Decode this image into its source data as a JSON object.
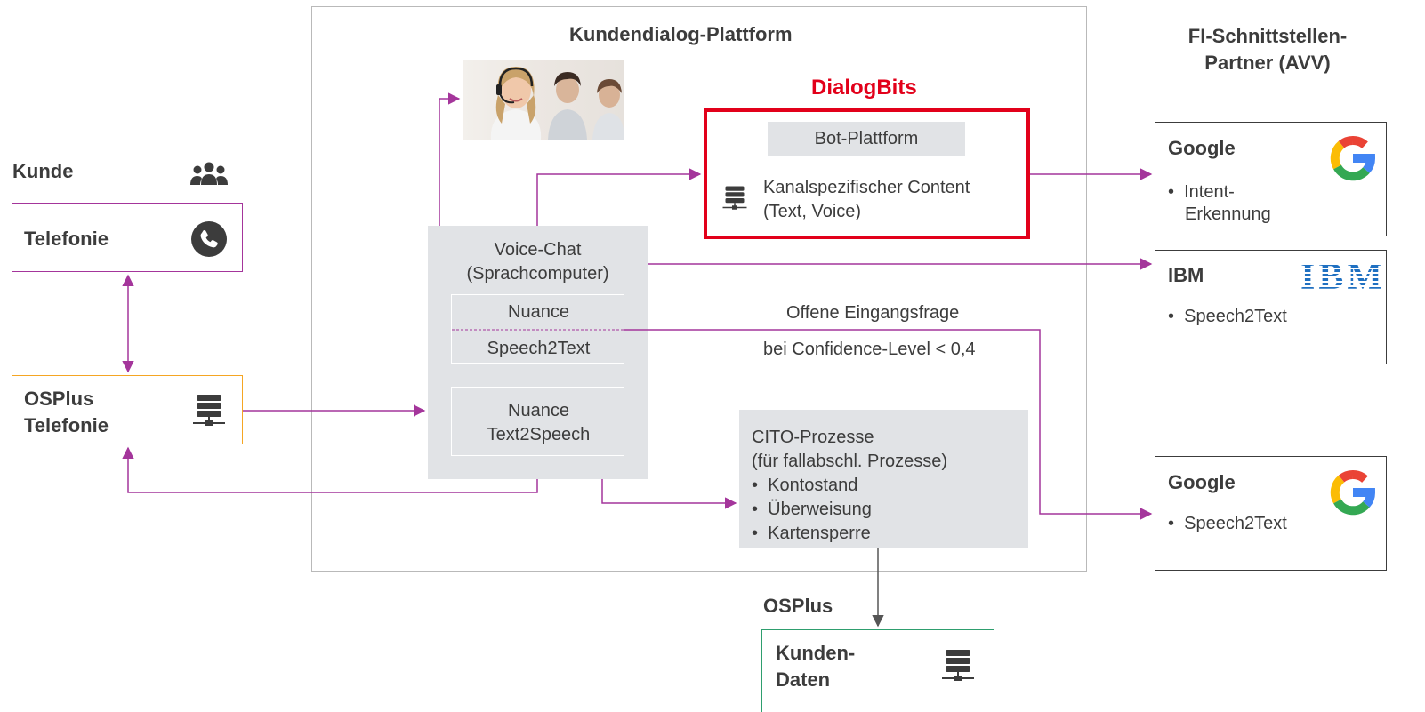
{
  "platform": {
    "title": "Kundendialog-Plattform"
  },
  "partners": {
    "title_line1": "FI-Schnittstellen-",
    "title_line2": "Partner (AVV)"
  },
  "customer": {
    "label": "Kunde",
    "telephony": "Telefonie"
  },
  "osplus_telephony": {
    "line1": "OSPlus",
    "line2": "Telefonie"
  },
  "dialogbits": {
    "title": "DialogBits",
    "bot_platform": "Bot-Plattform",
    "content_line1": "Kanalspezifischer Content",
    "content_line2": "(Text, Voice)"
  },
  "voice_chat": {
    "line1": "Voice-Chat",
    "line2": "(Sprachcomputer)",
    "nuance": "Nuance",
    "speech2text": "Speech2Text",
    "tts_line1": "Nuance",
    "tts_line2": "Text2Speech"
  },
  "annotation": {
    "line1": "Offene Eingangsfrage",
    "line2": "bei Confidence-Level < 0,4"
  },
  "cito": {
    "line1": "CITO-Prozesse",
    "line2": "(für fallabschl. Prozesse)",
    "items": [
      "Kontostand",
      "Überweisung",
      "Kartensperre"
    ]
  },
  "osplus": {
    "label": "OSPlus",
    "data_line1": "Kunden-",
    "data_line2": "Daten"
  },
  "google1": {
    "name": "Google",
    "item_line1": "Intent-",
    "item_line2": "Erkennung"
  },
  "ibm": {
    "name": "IBM",
    "logo": "IBM",
    "item": "Speech2Text"
  },
  "google2": {
    "name": "Google",
    "item": "Speech2Text"
  },
  "colors": {
    "purple": "#a4359b",
    "red": "#e2001a",
    "orange": "#f5a623",
    "green": "#2e9e6e",
    "gray_box": "#e1e3e6",
    "dark": "#3c3c3c"
  }
}
